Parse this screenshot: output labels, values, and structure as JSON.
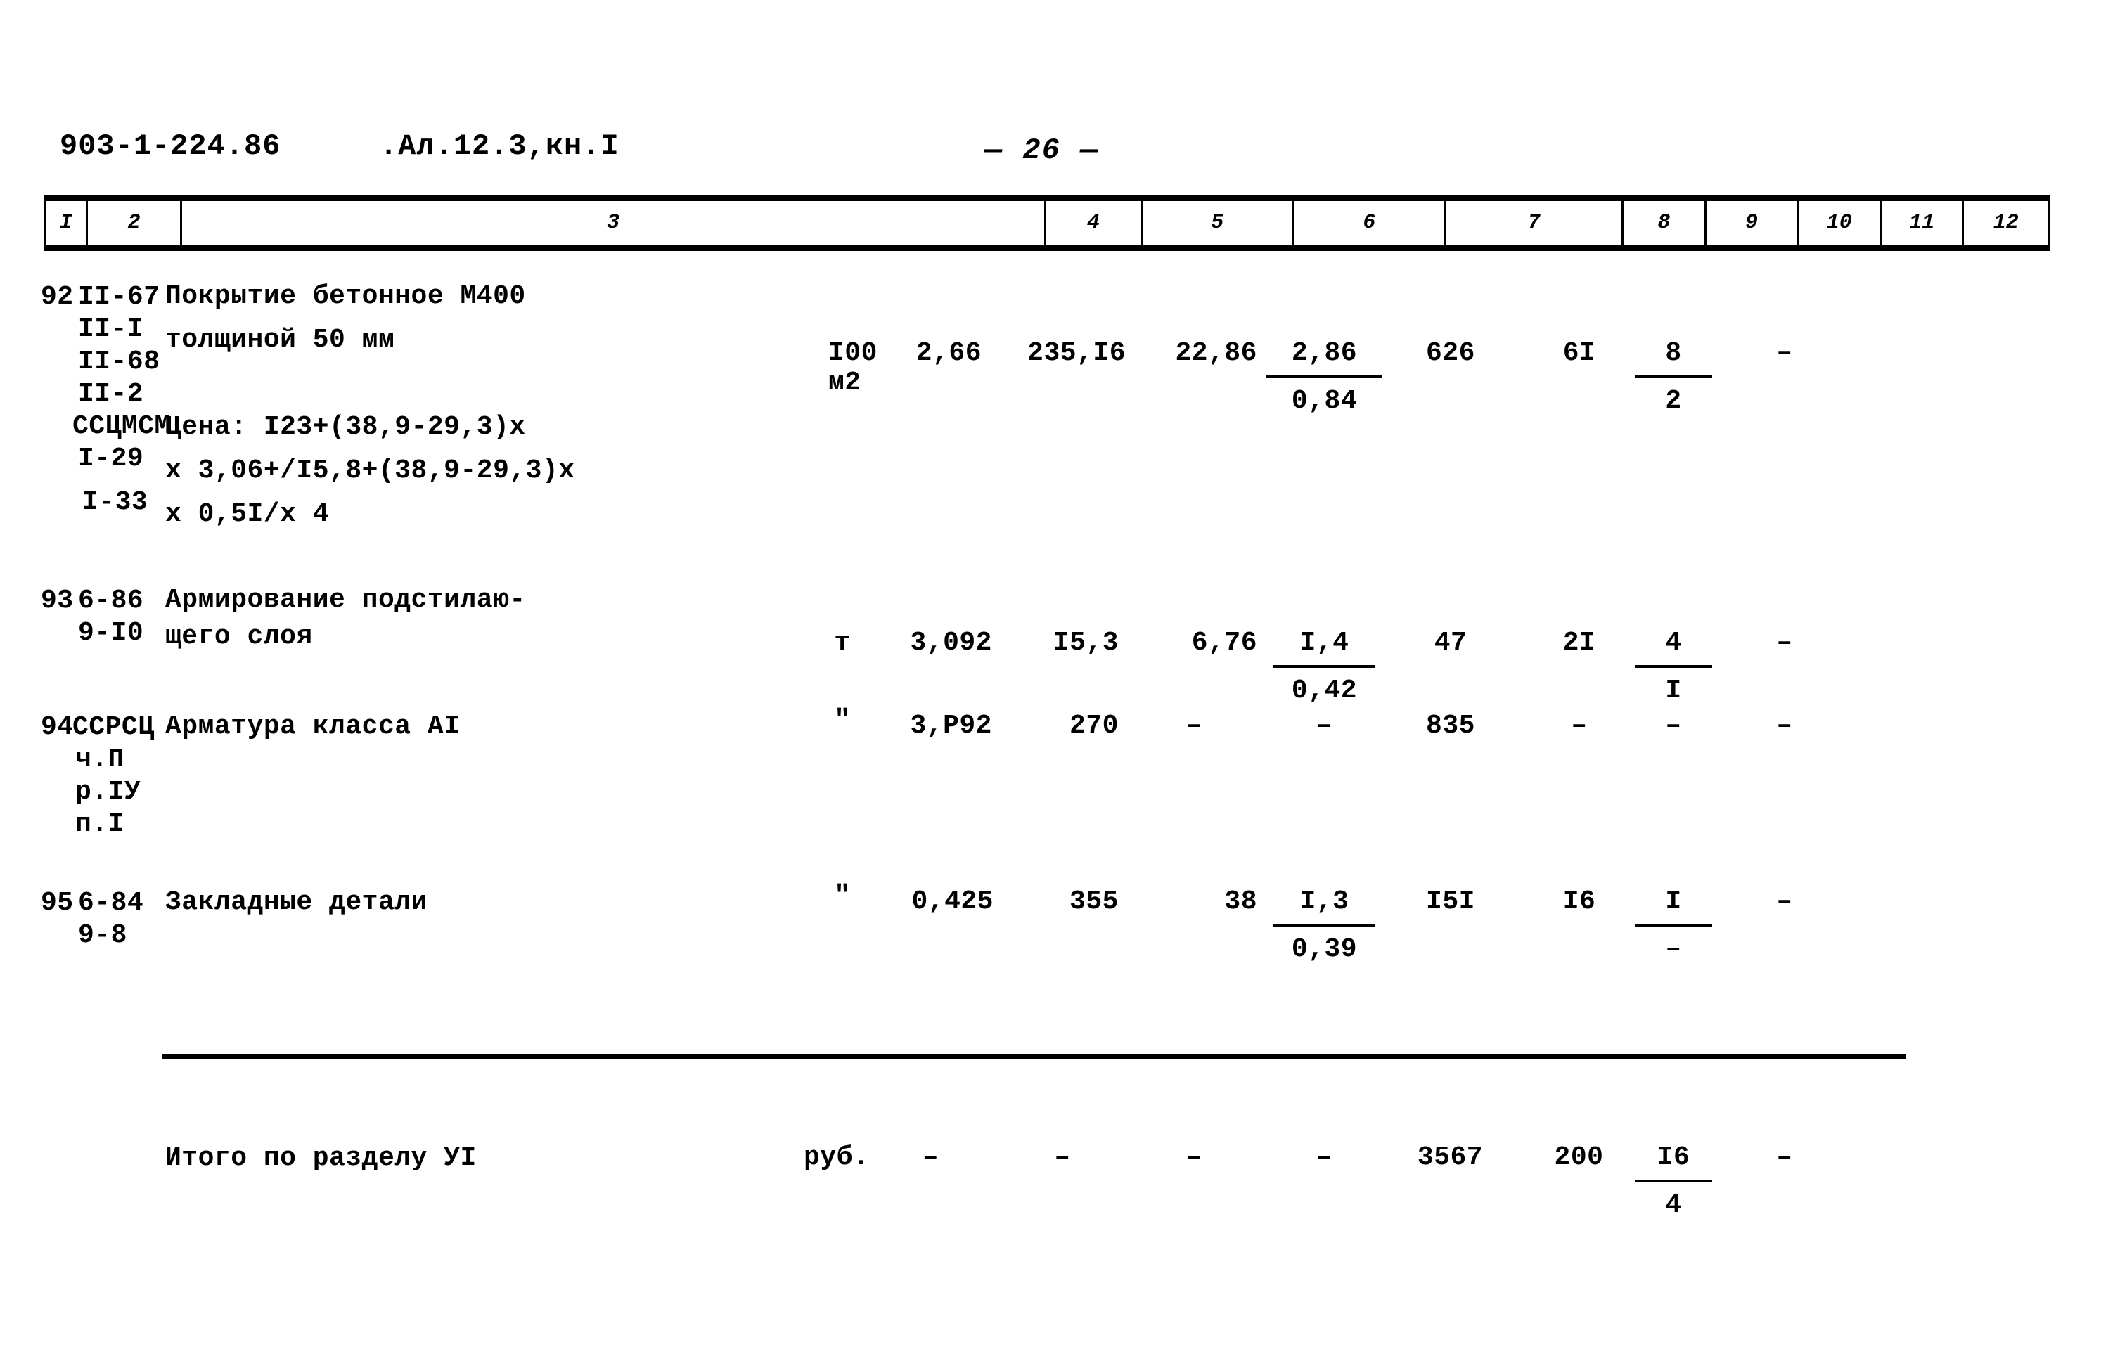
{
  "header": {
    "doc_code": "903-1-224.86",
    "album": ".Ал.12.3,кн.I",
    "page_number": "— 26 —"
  },
  "table": {
    "column_headers": [
      "I",
      "2",
      "3",
      "4",
      "5",
      "6",
      "7",
      "8",
      "9",
      "10",
      "11",
      "12"
    ],
    "rows": [
      {
        "num": "92",
        "code_lines": [
          "II-67",
          "II-I",
          "II-68",
          "II-2",
          "ССЦМСМ",
          "I-29",
          "",
          "I-33"
        ],
        "desc_lines": [
          "Покрытие бетонное М400",
          "толщиной 50 мм",
          "",
          "Цена: I23+(38,9-29,3)х",
          "х 3,06+/I5,8+(38,9-29,3)х",
          "х 0,5I/х 4"
        ],
        "unit_top": "I00",
        "unit_bottom": "м2",
        "c5": "2,66",
        "c6": "235,I6",
        "c7": "22,86",
        "c8_top": "2,86",
        "c8_bottom": "0,84",
        "c9": "626",
        "c10": "6I",
        "c11_top": "8",
        "c11_bottom": "2",
        "c12": "–"
      },
      {
        "num": "93",
        "code_lines": [
          "6-86",
          "9-I0"
        ],
        "desc_lines": [
          "Армирование подстилаю-",
          "щего слоя"
        ],
        "unit_top": "т",
        "unit_bottom": "",
        "c5": "3,092",
        "c6": "I5,3",
        "c7": "6,76",
        "c8_top": "I,4",
        "c8_bottom": "0,42",
        "c9": "47",
        "c10": "2I",
        "c11_top": "4",
        "c11_bottom": "I",
        "c12": "–"
      },
      {
        "num": "94",
        "code_lines": [
          "ССРСЦ",
          "ч.П",
          "р.IУ",
          "п.I"
        ],
        "desc_lines": [
          "Арматура класса АI"
        ],
        "unit_top": "\"",
        "unit_bottom": "",
        "c5": "3,Р92",
        "c6": "270",
        "c7": "–",
        "c8_top": "–",
        "c8_bottom": "",
        "c9": "835",
        "c10": "–",
        "c11_top": "–",
        "c11_bottom": "",
        "c12": "–"
      },
      {
        "num": "95",
        "code_lines": [
          "6-84",
          "9-8"
        ],
        "desc_lines": [
          "Закладные детали"
        ],
        "unit_top": "\"",
        "unit_bottom": "",
        "c5": "0,425",
        "c6": "355",
        "c7": "38",
        "c8_top": "I,3",
        "c8_bottom": "0,39",
        "c9": "I5I",
        "c10": "I6",
        "c11_top": "I",
        "c11_bottom": "–",
        "c12": "–"
      }
    ],
    "total_row": {
      "label": "Итого по разделу УI",
      "unit": "руб.",
      "c5": "–",
      "c6": "–",
      "c7": "–",
      "c8": "–",
      "c9": "3567",
      "c10": "200",
      "c11_top": "I6",
      "c11_bottom": "4",
      "c12": "–"
    }
  }
}
